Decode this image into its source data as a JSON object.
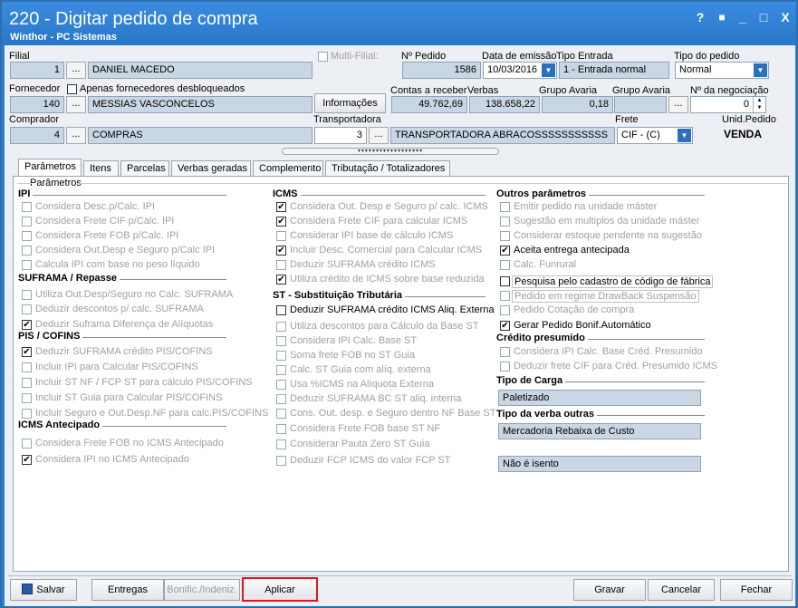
{
  "window": {
    "title": "220 - Digitar pedido de compra",
    "subtitle": "Winthor - PC Sistemas",
    "controls": [
      "?",
      "■",
      "_",
      "□",
      "X"
    ]
  },
  "header": {
    "filial_label": "Filial",
    "filial_code": "1",
    "filial_name": "DANIEL MACEDO",
    "multi_filial_label": "Multi-Filial:",
    "num_pedido_label": "Nº Pedido",
    "num_pedido": "1586",
    "data_emissao_label": "Data de emissão",
    "data_emissao": "10/03/2016",
    "tipo_entrada_label": "Tipo Entrada",
    "tipo_entrada": "1 - Entrada normal",
    "tipo_pedido_label": "Tipo do pedido",
    "tipo_pedido": "Normal",
    "fornecedor_label": "Fornecedor",
    "apenas_forn_label": "Apenas fornecedores desbloqueados",
    "fornecedor_code": "140",
    "fornecedor_name": "MESSIAS VASCONCELOS",
    "informacoes_label": "Informações",
    "contas_receber_label": "Contas a receber",
    "contas_receber": "49.762,69",
    "verbas_label": "Verbas",
    "verbas": "138.658,22",
    "grupo_avaria1_label": "Grupo Avaria",
    "grupo_avaria1": "0,18",
    "grupo_avaria2_label": "Grupo Avaria",
    "negociacao_label": "Nº da negociação",
    "negociacao": "0",
    "comprador_label": "Comprador",
    "comprador_code": "4",
    "comprador_name": "COMPRAS",
    "transportadora_label": "Transportadora",
    "transportadora_code": "3",
    "transportadora_name": "TRANSPORTADORA ABRACOSSSSSSSSSSS",
    "frete_label": "Frete",
    "frete": "CIF - (C)",
    "unid_pedido_label": "Unid.Pedido",
    "unid_pedido": "VENDA",
    "dots": "..."
  },
  "tabs": [
    "Parâmetros",
    "Itens",
    "Parcelas",
    "Verbas geradas",
    "Complemento",
    "Tributação / Totalizadores"
  ],
  "panel_title": "Parâmetros",
  "col1": {
    "ipi_title": "IPI",
    "ipi": [
      "Considera Desc.p/Calc. IPI",
      "Considera Frete CIF p/Calc. IPI",
      "Considera Frete FOB p/Calc. IPI",
      "Considera Out.Desp e Seguro p/Calc IPI",
      "Calcula IPI com base no peso líquido"
    ],
    "suframa_title": "SUFRAMA / Repasse",
    "suframa": [
      "Utiliza Out.Desp/Seguro no Calc. SUFRAMA",
      "Deduzir descontos p/ calc. SUFRAMA",
      "Deduzir Suframa Diferença de Alíquotas"
    ],
    "pis_title": "PIS / COFINS",
    "pis": [
      "Deduzir SUFRAMA crédito PIS/COFINS",
      "Incluir IPI para Calcular PIS/COFINS",
      "Incluir ST NF / FCP ST para cálculo PIS/COFINS",
      "Incluir ST Guia para Calcular PIS/COFINS",
      "Incluir Seguro e Out.Desp.NF para calc.PIS/COFINS"
    ],
    "icmsant_title": "ICMS Antecipado",
    "icmsant": [
      "Considera Frete FOB no ICMS Antecipado",
      "Considera IPI no ICMS Antecipado"
    ]
  },
  "col2": {
    "icms_title": "ICMS",
    "icms": [
      "Considera Out. Desp e Seguro p/ calc. ICMS",
      "Considera Frete CIF para calcular ICMS",
      "Considerar IPI base de cálculo ICMS",
      "Incluir Desc. Comercial  para Calcular ICMS",
      "Deduzir SUFRAMA crédito ICMS",
      "Utiliza crédito de ICMS sobre base reduzida"
    ],
    "st_title": "ST - Substituição Tributária",
    "st": [
      "Deduzir SUFRAMA crédito ICMS Aliq. Externa",
      "Utiliza descontos para Cálculo da Base ST",
      "Considera IPI Calc. Base ST",
      "Soma frete FOB no ST Guia",
      "Calc. ST Guia com alíq. externa",
      "Usa %ICMS na Alíquota Externa",
      "Deduzir SUFRAMA BC ST aliq. interna",
      "Cons. Out. desp. e Seguro dentro NF Base ST",
      "Considera Frete FOB base ST NF",
      "Considerar Pauta Zero ST Guia",
      "Deduzir FCP ICMS do valor FCP ST"
    ]
  },
  "col3": {
    "outros_title": "Outros parâmetros",
    "outros": [
      "Emitir pedido na unidade máster",
      "Sugestão em multiplos da unidade máster",
      "Considerar estoque pendente na sugestão",
      "Aceita entrega antecipada",
      "Calc. Funrural",
      "Pesquisa pelo cadastro de código de fábrica",
      "Pedido em regime DrawBack Suspensão",
      "Pedido Cotação de compra",
      "Gerar Pedido Bonif.Automático"
    ],
    "credito_title": "Crédito presumido",
    "credito": [
      "Considera IPI Calc. Base Créd. Presumido",
      "Deduzir frete CIF para Créd. Presumido ICMS"
    ],
    "carga_title": "Tipo de Carga",
    "carga": "Paletizado",
    "verba_title": "Tipo da verba outras",
    "verba": "Mercadoria Rebaixa de Custo",
    "isento": "Não é isento"
  },
  "footer": {
    "salvar": "Salvar",
    "entregas": "Entregas",
    "bonific": "Bonific./Indeniz.",
    "aplicar": "Aplicar",
    "gravar": "Gravar",
    "cancelar": "Cancelar",
    "fechar": "Fechar"
  },
  "colors": {
    "title_bar": "#2d7fd1",
    "highlight": "#e01818"
  }
}
